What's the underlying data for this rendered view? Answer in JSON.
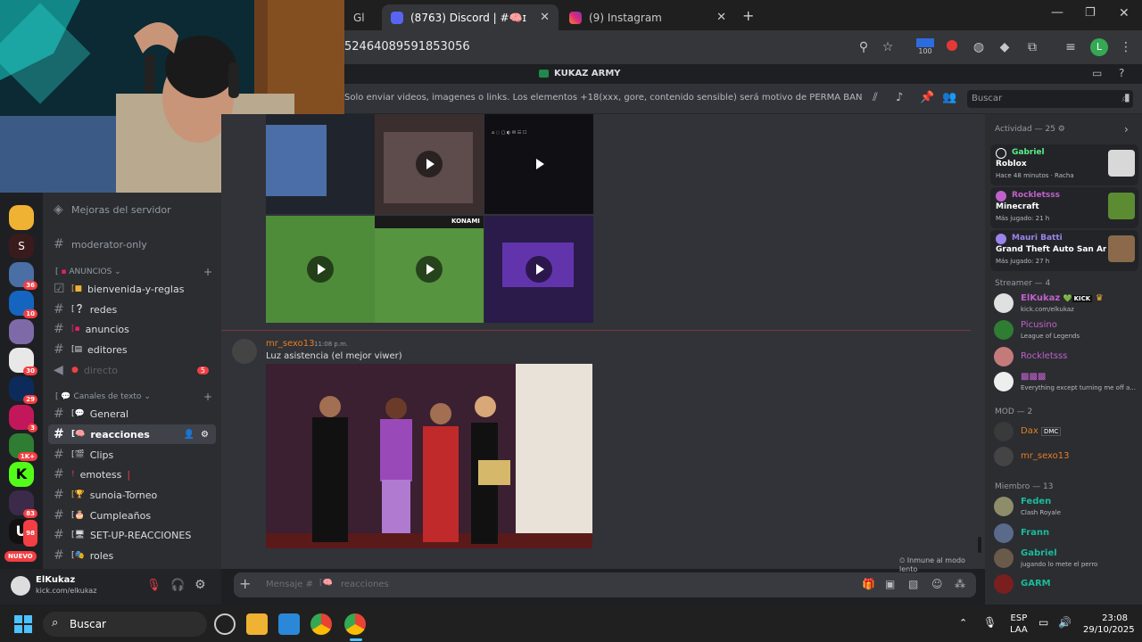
{
  "browser": {
    "tabs": [
      {
        "label": "Gl",
        "active": false
      },
      {
        "label": "(8763) Discord | #🧠ɪreac",
        "active": true
      },
      {
        "label": "(9) Instagram",
        "active": false
      }
    ],
    "url": "52464089591853056",
    "extension_badge": "100",
    "profile_initial": "L"
  },
  "discord": {
    "window_title": "KUKAZ ARMY",
    "topic": "Solo enviar videos, imagenes o links. Los elementos +18(xxx, gore, contenido sensible) será motivo de PERMA BAN de discord y del canal de twit...",
    "search_placeholder": "Buscar",
    "server_badges": [
      "36",
      "10",
      "30",
      "29",
      "3",
      "1K+",
      "83",
      "98"
    ],
    "new_badge": "NUEVO",
    "channels": {
      "top": [
        {
          "name": "Mejoras del servidor"
        },
        {
          "name": "moderator-only"
        }
      ],
      "cat1": "ANUNCIOS",
      "cat1_items": [
        {
          "name": "bienvenida-y-reglas"
        },
        {
          "name": "redes"
        },
        {
          "name": "anuncios"
        },
        {
          "name": "editores"
        },
        {
          "name": "directo",
          "badge": "5"
        }
      ],
      "cat2": "Canales de texto",
      "cat2_items": [
        {
          "name": "General"
        },
        {
          "name": "reacciones"
        },
        {
          "name": "Clips"
        },
        {
          "name": "emotess"
        },
        {
          "name": "sunoia-Torneo"
        },
        {
          "name": "Cumpleaños"
        },
        {
          "name": "SET-UP-REACCIONES"
        },
        {
          "name": "roles"
        }
      ]
    },
    "user": {
      "name": "ElKukaz",
      "status": "kick.com/elkukaz"
    },
    "message": {
      "author": "mr_sexo13",
      "time": "11:08 p.m.",
      "text": "Luz asistencia (el mejor viwer)"
    },
    "video_labels": {
      "konami": "KONAMI"
    },
    "immune_note": "Inmune al modo lento",
    "composer_placeholder": "Mensaje #",
    "composer_channel": "reacciones",
    "members": {
      "activity_header": "Actividad — 25",
      "activities": [
        {
          "name": "Gabriel",
          "game": "Roblox",
          "sub": "Hace 48 minutos · Racha",
          "color": "#57f287"
        },
        {
          "name": "Rockletsss",
          "game": "Minecraft",
          "sub": "Más jugado: 21 h",
          "color": "#c061cb"
        },
        {
          "name": "Mauri Batti",
          "game": "Grand Theft Auto San Andr...",
          "sub": "Más jugado: 27 h",
          "color": "#9b84ec"
        }
      ],
      "streamer_header": "Streamer — 4",
      "streamers": [
        {
          "name": "ElKukaz",
          "status": "kick.com/elkukaz",
          "tag": "KICK",
          "color": "#c061cb"
        },
        {
          "name": "Picusino",
          "status": "League of Legends",
          "color": "#c061cb"
        },
        {
          "name": "Rockletsss",
          "status": "",
          "color": "#c061cb"
        },
        {
          "name": "",
          "status": "Everything except turning me off a...",
          "color": "#c061cb"
        }
      ],
      "mod_header": "MOD — 2",
      "mods": [
        {
          "name": "Dax",
          "tag": "DMC",
          "color": "#e67e22"
        },
        {
          "name": "mr_sexo13",
          "color": "#e67e22"
        }
      ],
      "member_header": "Miembro — 13",
      "regular": [
        {
          "name": "Feden",
          "status": "Clash Royale",
          "color": "#1abc9c"
        },
        {
          "name": "Frann",
          "status": "",
          "color": "#1abc9c"
        },
        {
          "name": "Gabriel",
          "status": "jugando lo mete el perro",
          "color": "#1abc9c"
        },
        {
          "name": "GARM",
          "status": "",
          "color": "#1abc9c"
        }
      ]
    }
  },
  "taskbar": {
    "search": "Buscar",
    "lang1": "ESP",
    "lang2": "LAA",
    "time": "23:08",
    "date": "29/10/2025"
  }
}
